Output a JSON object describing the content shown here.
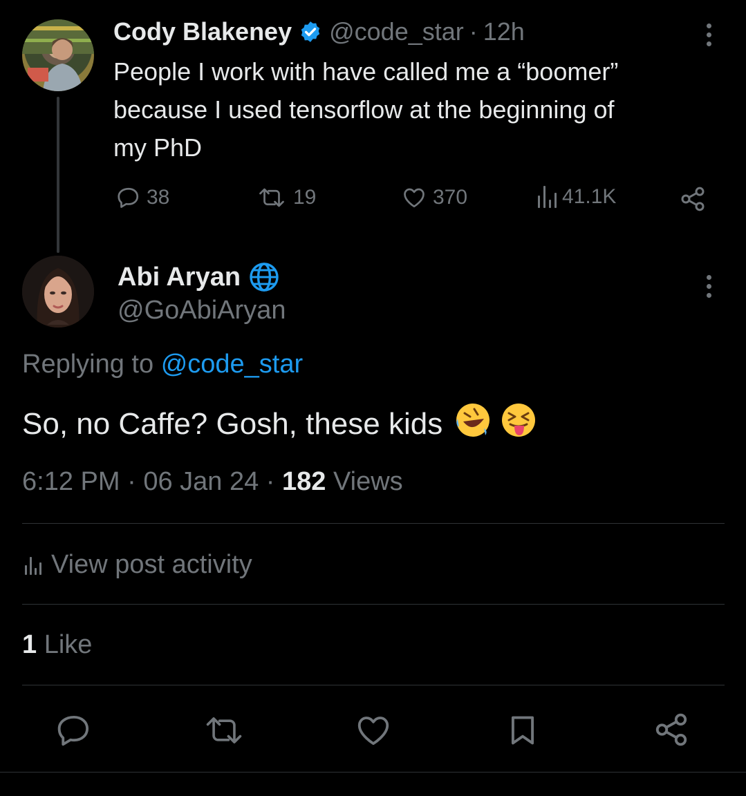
{
  "parent_post": {
    "author_name": "Cody Blakeney",
    "handle": "@code_star",
    "separator": "·",
    "time_ago": "12h",
    "text_lines": [
      "People I work with have called me a “boomer”",
      "because I used tensorflow at the beginning of",
      "my PhD"
    ],
    "replies": "38",
    "reposts": "19",
    "likes": "370",
    "views": "41.1K"
  },
  "reply_post": {
    "author_name": "Abi Aryan",
    "handle": "@GoAbiAryan",
    "replying_prefix": "Replying to",
    "replying_to": "@code_star",
    "text": "So, no Caffe? Gosh, these kids",
    "emojis": [
      "🤣",
      "😝"
    ],
    "time": "6:12 PM",
    "separator": "·",
    "date": "06 Jan 24",
    "views_count": "182",
    "views_label": "Views"
  },
  "activity": {
    "label": "View post activity"
  },
  "likes_summary": {
    "count": "1",
    "label": "Like"
  },
  "colors": {
    "background": "#000000",
    "text": "#e7e9ea",
    "muted": "#71767b",
    "link": "#1d9bf0",
    "verified": "#1d9bf0",
    "divider": "#2f3336"
  },
  "icons": [
    "verified-badge-icon",
    "globe-icon",
    "reply-icon",
    "repost-icon",
    "like-icon",
    "views-icon",
    "share-icon",
    "bookmark-icon",
    "more-icon"
  ]
}
